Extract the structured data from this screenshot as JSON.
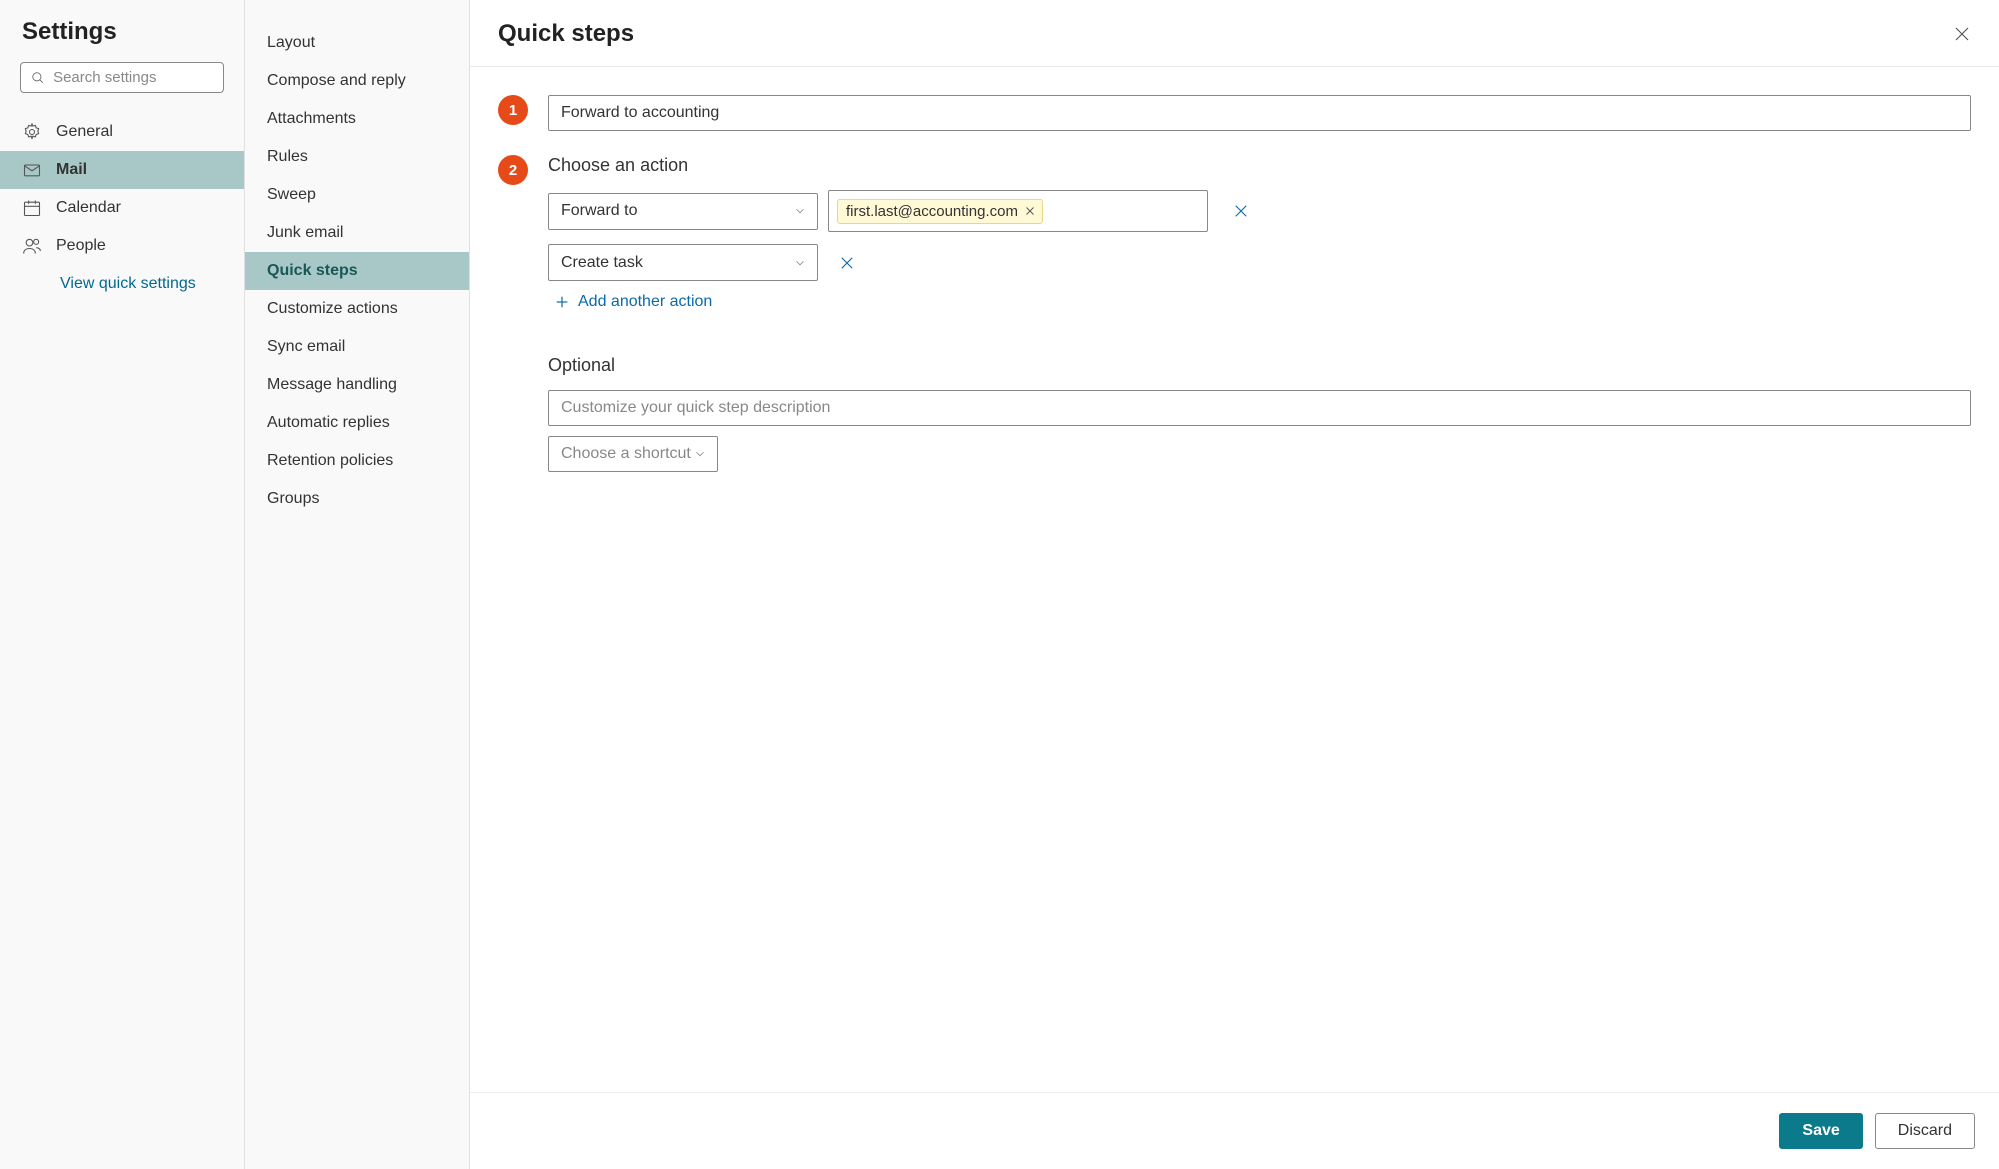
{
  "sidebar": {
    "title": "Settings",
    "search_placeholder": "Search settings",
    "nav": [
      {
        "label": "General"
      },
      {
        "label": "Mail"
      },
      {
        "label": "Calendar"
      },
      {
        "label": "People"
      }
    ],
    "quick_link": "View quick settings"
  },
  "sublist": {
    "items": [
      {
        "label": "Layout"
      },
      {
        "label": "Compose and reply"
      },
      {
        "label": "Attachments"
      },
      {
        "label": "Rules"
      },
      {
        "label": "Sweep"
      },
      {
        "label": "Junk email"
      },
      {
        "label": "Quick steps"
      },
      {
        "label": "Customize actions"
      },
      {
        "label": "Sync email"
      },
      {
        "label": "Message handling"
      },
      {
        "label": "Automatic replies"
      },
      {
        "label": "Retention policies"
      },
      {
        "label": "Groups"
      }
    ]
  },
  "main": {
    "title": "Quick steps",
    "step1": {
      "number": "1",
      "name_value": "Forward to accounting"
    },
    "step2": {
      "number": "2",
      "label": "Choose an action",
      "action1": {
        "label": "Forward to",
        "recipient": "first.last@accounting.com"
      },
      "action2": {
        "label": "Create task"
      },
      "add_action": "Add another action"
    },
    "optional": {
      "label": "Optional",
      "desc_placeholder": "Customize your quick step description",
      "shortcut_label": "Choose a shortcut"
    },
    "save": "Save",
    "discard": "Discard"
  }
}
